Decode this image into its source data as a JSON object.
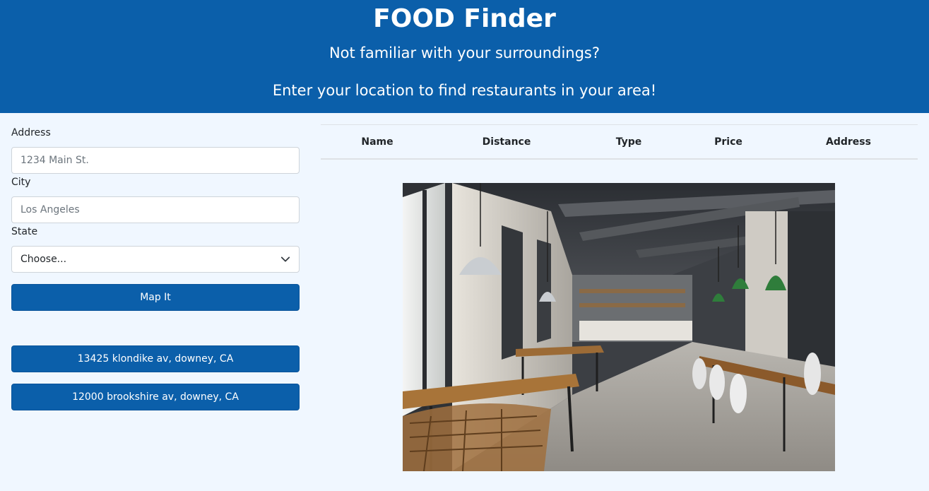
{
  "header": {
    "title": "FOOD Finder",
    "subtitle1": "Not familiar with your surroundings?",
    "subtitle2": "Enter your location to find restaurants in your area!"
  },
  "form": {
    "address_label": "Address",
    "address_placeholder": "1234 Main St.",
    "city_label": "City",
    "city_placeholder": "Los Angeles",
    "state_label": "State",
    "state_selected": "Choose...",
    "submit_label": "Map It"
  },
  "saved_addresses": [
    "13425 klondike av, downey, CA",
    "12000 brookshire av, downey, CA"
  ],
  "table": {
    "columns": [
      "Name",
      "Distance",
      "Type",
      "Price",
      "Address"
    ]
  },
  "image": {
    "icon": "restaurant-interior-photo"
  },
  "colors": {
    "primary": "#0b5faa",
    "background": "#f0f7ff"
  }
}
